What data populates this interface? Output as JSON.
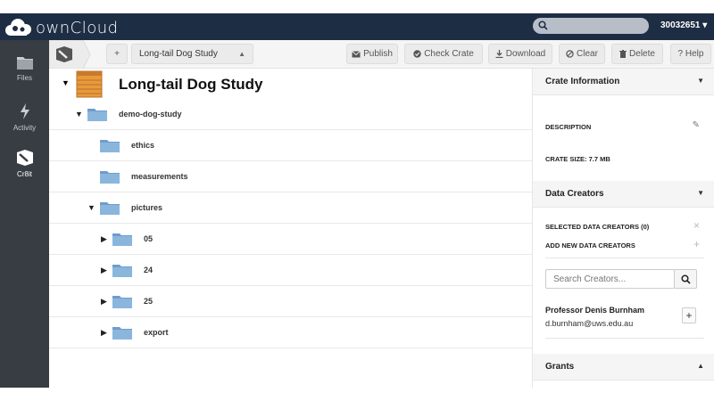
{
  "header": {
    "brand": "ownCloud",
    "search_placeholder": "",
    "user": "30032651 ▾"
  },
  "nav": {
    "items": [
      {
        "label": "Files",
        "icon": "folder-icon"
      },
      {
        "label": "Activity",
        "icon": "lightning-icon"
      },
      {
        "label": "Cr8it",
        "icon": "crate-icon"
      }
    ]
  },
  "toolbar": {
    "add_label": "+",
    "crate_select": "Long-tail Dog Study",
    "publish": "Publish",
    "check_crate": "Check Crate",
    "download": "Download",
    "clear": "Clear",
    "delete": "Delete",
    "help": "? Help"
  },
  "tree": {
    "root": "Long-tail Dog Study",
    "rows": [
      {
        "label": "demo-dog-study",
        "expanded": true
      },
      {
        "label": "ethics"
      },
      {
        "label": "measurements"
      },
      {
        "label": "pictures",
        "expanded": true
      },
      {
        "label": "05",
        "collapsed": true
      },
      {
        "label": "24",
        "collapsed": true
      },
      {
        "label": "25",
        "collapsed": true
      },
      {
        "label": "export",
        "collapsed": true
      }
    ]
  },
  "panel": {
    "crate_info_title": "Crate Information",
    "description_label": "DESCRIPTION",
    "crate_size": "CRATE SIZE: 7.7 MB",
    "data_creators_title": "Data Creators",
    "selected_creators": "SELECTED DATA CREATORS (0)",
    "add_new_creators": "ADD NEW DATA CREATORS",
    "search_placeholder": "Search Creators...",
    "creator_name": "Professor Denis Burnham",
    "creator_email": "d.burnham@uws.edu.au",
    "grants_title": "Grants",
    "edit_glyph": "✎",
    "remove_glyph": "×",
    "add_glyph": "+",
    "plus_glyph": "+"
  },
  "colors": {
    "header_bg": "#1d2d44",
    "nav_bg": "#383c43",
    "folder_blue": "#8ab6dd",
    "crate_orange": "#e89a3c"
  }
}
